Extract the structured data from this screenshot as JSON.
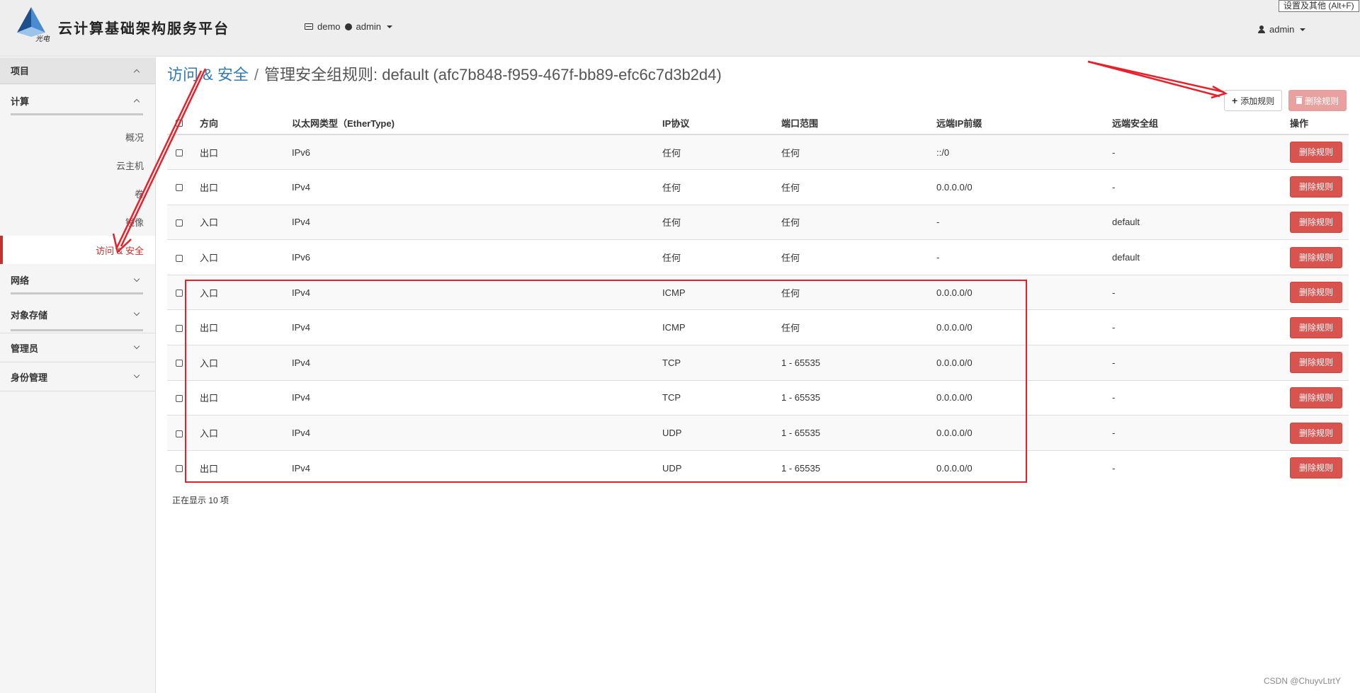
{
  "header": {
    "brand": "云计算基础架构服务平台",
    "project": "demo",
    "domain_user": "admin",
    "user": "admin",
    "tooltip": "设置及其他 (Alt+F)"
  },
  "sidebar": {
    "sections": [
      {
        "label": "项目"
      },
      {
        "label": "计算"
      },
      {
        "label": "网络"
      },
      {
        "label": "对象存储"
      },
      {
        "label": "管理员"
      },
      {
        "label": "身份管理"
      }
    ],
    "compute_items": [
      "概况",
      "云主机",
      "卷",
      "镜像",
      "访问 & 安全"
    ]
  },
  "breadcrumb": {
    "parent": "访问 & 安全",
    "separator": "/",
    "title": "管理安全组规则: default (afc7b848-f959-467f-bb89-efc6c7d3b2d4)"
  },
  "actions": {
    "add_label": "添加规则",
    "delete_all_label": "删除规则"
  },
  "table": {
    "headers": [
      "方向",
      "以太网类型（EtherType)",
      "IP协议",
      "端口范围",
      "远端IP前缀",
      "远端安全组",
      "操作"
    ],
    "row_action": "删除规则",
    "rows": [
      [
        "出口",
        "IPv6",
        "任何",
        "任何",
        "::/0",
        "-"
      ],
      [
        "出口",
        "IPv4",
        "任何",
        "任何",
        "0.0.0.0/0",
        "-"
      ],
      [
        "入口",
        "IPv4",
        "任何",
        "任何",
        "-",
        "default"
      ],
      [
        "入口",
        "IPv6",
        "任何",
        "任何",
        "-",
        "default"
      ],
      [
        "入口",
        "IPv4",
        "ICMP",
        "任何",
        "0.0.0.0/0",
        "-"
      ],
      [
        "出口",
        "IPv4",
        "ICMP",
        "任何",
        "0.0.0.0/0",
        "-"
      ],
      [
        "入口",
        "IPv4",
        "TCP",
        "1 - 65535",
        "0.0.0.0/0",
        "-"
      ],
      [
        "出口",
        "IPv4",
        "TCP",
        "1 - 65535",
        "0.0.0.0/0",
        "-"
      ],
      [
        "入口",
        "IPv4",
        "UDP",
        "1 - 65535",
        "0.0.0.0/0",
        "-"
      ],
      [
        "出口",
        "IPv4",
        "UDP",
        "1 - 65535",
        "0.0.0.0/0",
        "-"
      ]
    ],
    "footer": "正在显示 10 项"
  },
  "watermark": "CSDN @ChuyvLtrtY",
  "colors": {
    "accent": "#337ab7",
    "danger": "#d9534f",
    "annotation": "#e8202a"
  }
}
